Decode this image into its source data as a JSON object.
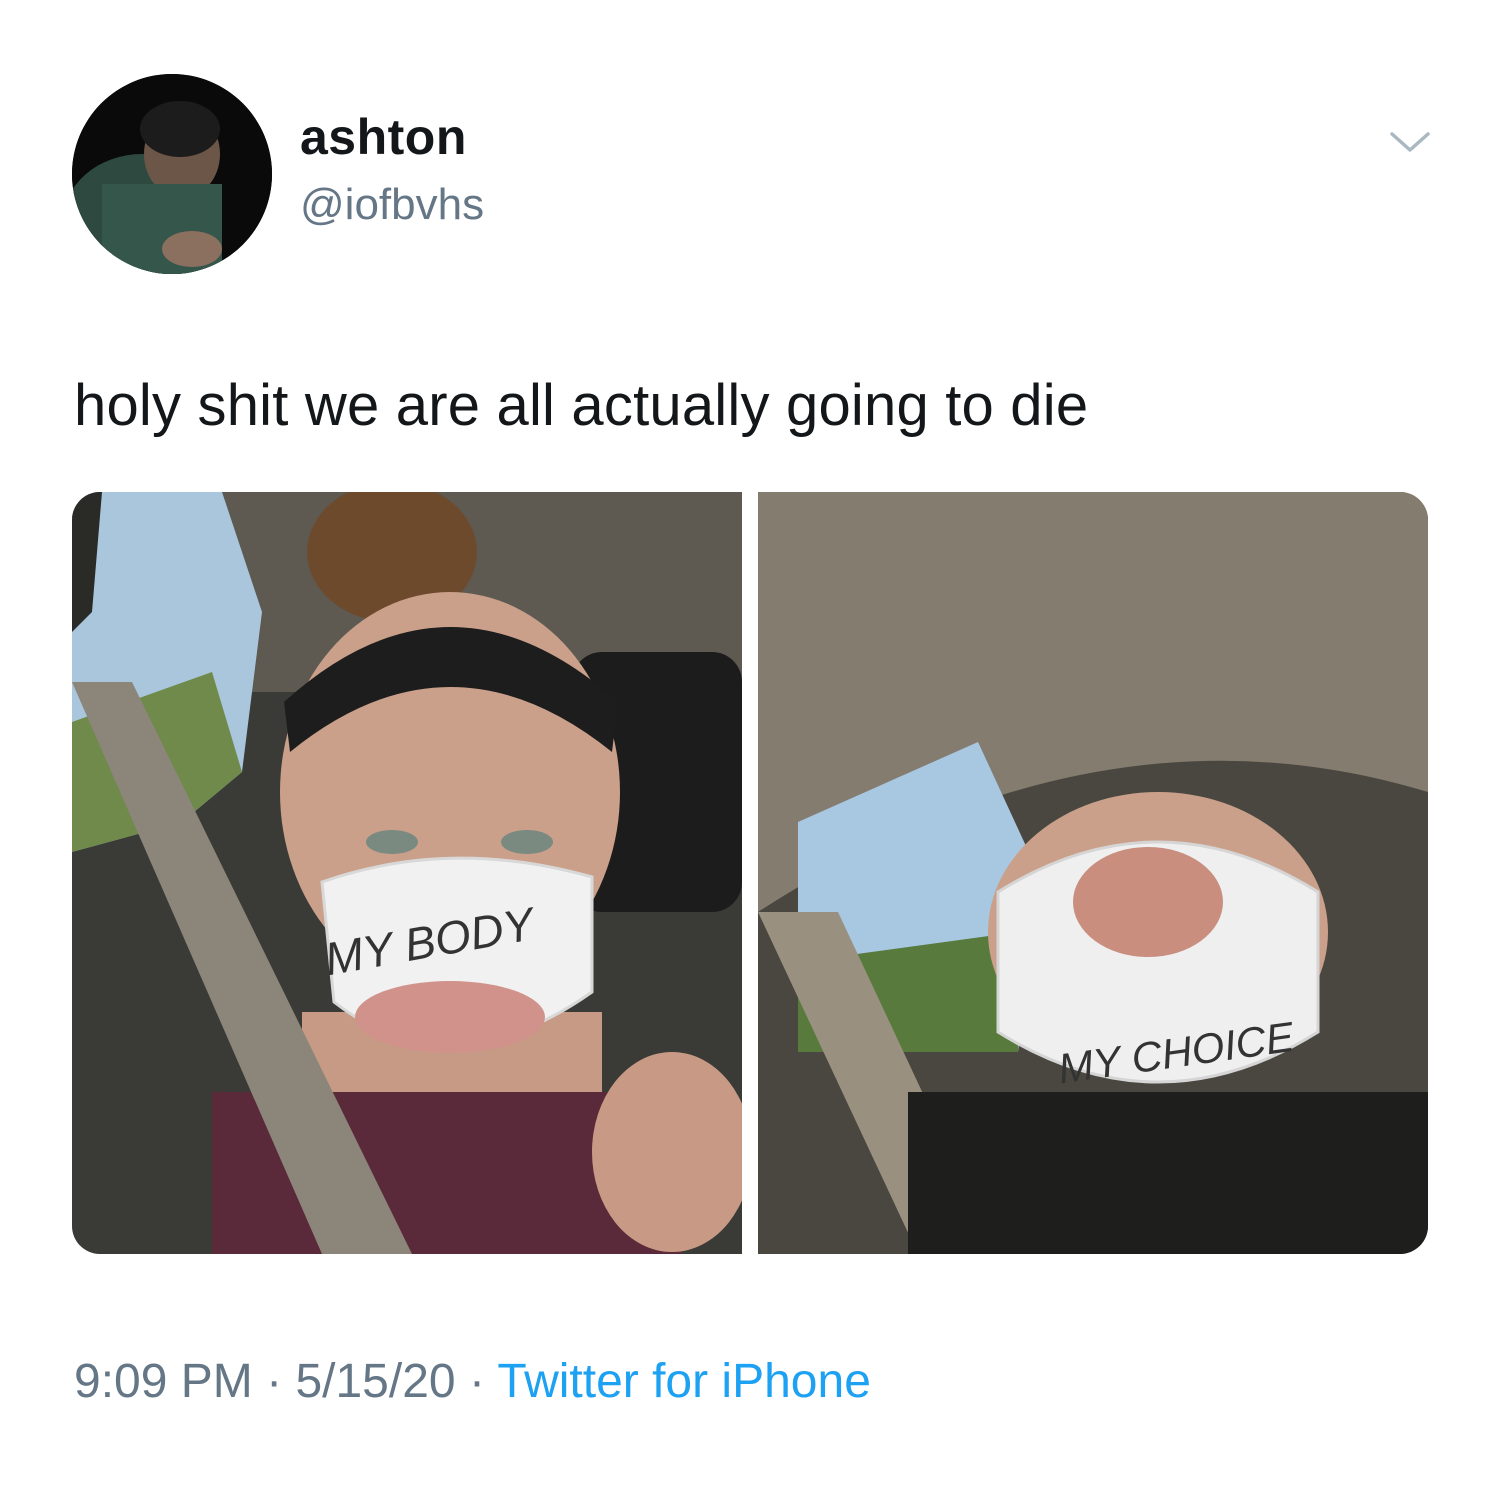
{
  "user": {
    "display_name": "ashton",
    "handle": "@iofbvhs",
    "avatar_icon": "avatar-photo"
  },
  "tweet": {
    "text": "holy shit we are all actually going to die",
    "time": "9:09 PM",
    "separator": "·",
    "date": "5/15/20",
    "source": "Twitter for iPhone"
  },
  "media": {
    "photos": [
      {
        "mask_text": "MY BODY"
      },
      {
        "mask_text": "MY CHOICE"
      }
    ]
  },
  "icons": {
    "menu": "chevron-down-icon"
  },
  "colors": {
    "text": "#14171a",
    "secondary": "#657786",
    "link": "#1da1f2"
  }
}
